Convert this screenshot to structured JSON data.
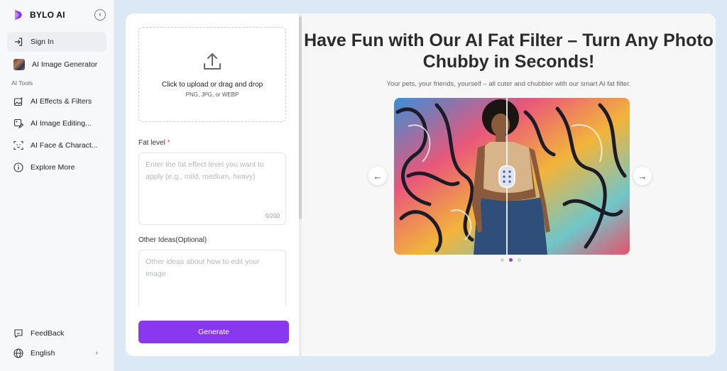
{
  "brand": {
    "name": "BYLO AI"
  },
  "sidebar": {
    "sign_in": "Sign In",
    "image_generator": "AI Image Generator",
    "section_label": "AI Tools",
    "items": [
      {
        "label": "AI Effects & Filters",
        "icon": "image-sparkle-icon"
      },
      {
        "label": "AI Image Editing...",
        "icon": "image-edit-icon"
      },
      {
        "label": "AI Face & Charact...",
        "icon": "face-scan-icon"
      },
      {
        "label": "Explore More",
        "icon": "info-icon"
      }
    ],
    "feedback": "FeedBack",
    "language": "English"
  },
  "form": {
    "upload_title": "Click to upload or drag and drop",
    "upload_formats": "PNG, JPG, or WEBP",
    "fat_level_label": "Fat level",
    "required_mark": "*",
    "fat_level_placeholder": "Enter the fat effect level you want to apply (e.g., mild, medium, heavy)",
    "fat_level_counter": "0/200",
    "other_ideas_label": "Other Ideas(Optional)",
    "other_ideas_placeholder": "Other ideas about how to edit your image",
    "generate_label": "Generate"
  },
  "hero": {
    "headline": "Have Fun with Our AI Fat Filter – Turn Any Photo Chubby in Seconds!",
    "subline": "Your pets, your friends, yourself – all cuter and chubbier with our smart AI fat filter.",
    "prev_arrow": "←",
    "next_arrow": "→",
    "slides_total": 3,
    "slide_active": 2
  },
  "colors": {
    "accent": "#8a37f0",
    "background": "#dbe9f6"
  }
}
